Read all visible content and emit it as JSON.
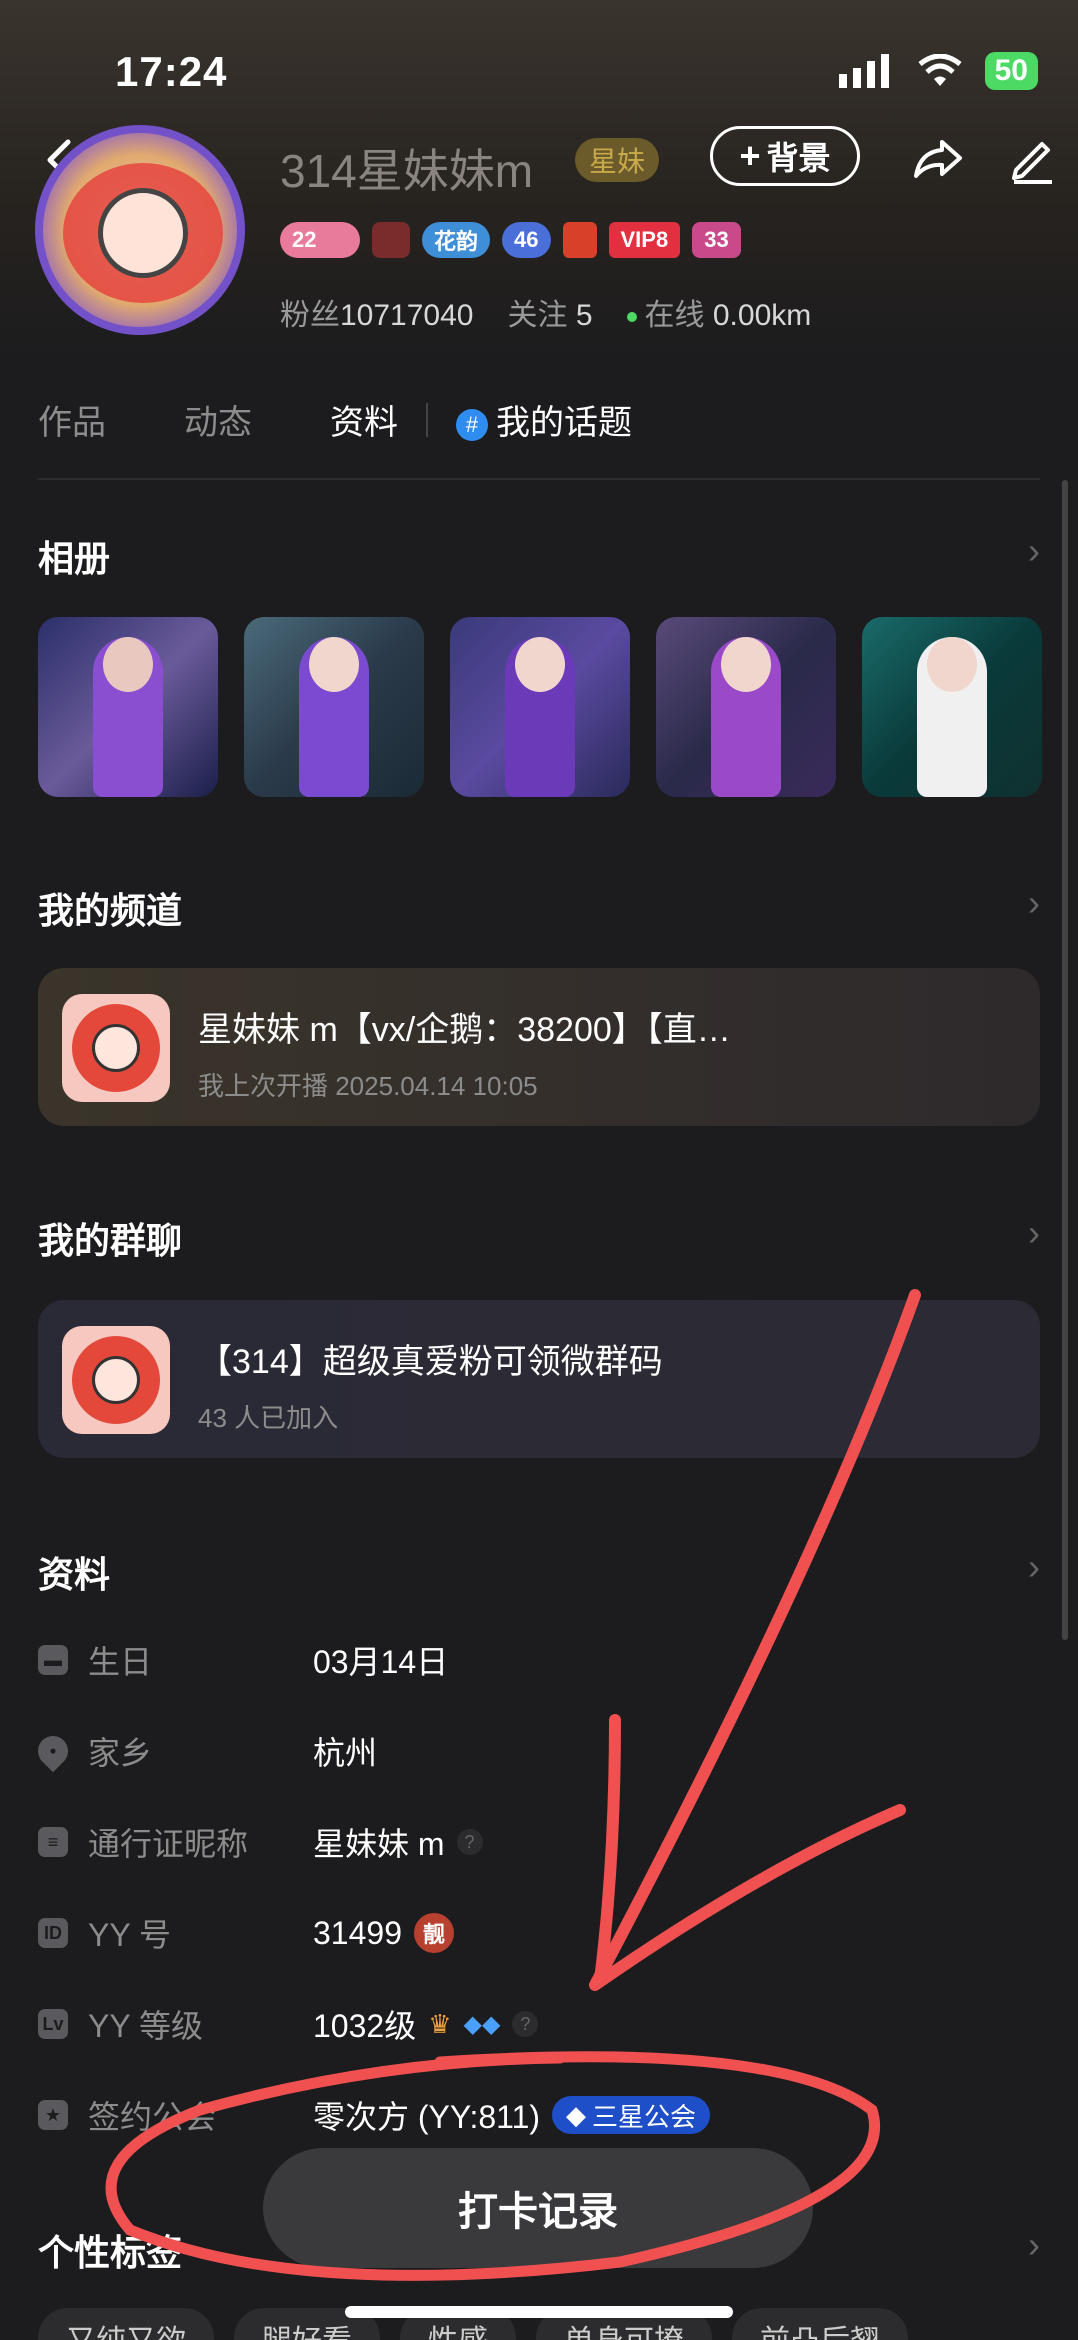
{
  "status_bar": {
    "time": "17:24",
    "battery": "50"
  },
  "profile": {
    "nickname": "314星妹妹m",
    "nick_tag": "星妹",
    "bg_button_label": "背景",
    "badges": [
      "22",
      "",
      "花韵",
      "46",
      "",
      "VIP8",
      "33"
    ],
    "fans_label": "粉丝",
    "fans_count": "10717040",
    "follow_label": "关注",
    "follow_count": "5",
    "online_label": "在线",
    "distance": "0.00km"
  },
  "tabs": [
    {
      "label": "作品"
    },
    {
      "label": "动态"
    },
    {
      "label": "资料"
    },
    {
      "label": "我的话题"
    }
  ],
  "album": {
    "title": "相册"
  },
  "channel": {
    "title": "我的频道",
    "name": "星妹妹 m【vx/企鹅：38200】【直…",
    "last_live": "我上次开播 2025.04.14 10:05"
  },
  "group": {
    "title": "我的群聊",
    "name": "【314】超级真爱粉可领微群码",
    "members": "43 人已加入"
  },
  "info": {
    "title": "资料",
    "rows": [
      {
        "icon": "cake-icon",
        "label": "生日",
        "value": "03月14日"
      },
      {
        "icon": "location-icon",
        "label": "家乡",
        "value": "杭州"
      },
      {
        "icon": "id-card-icon",
        "label": "通行证昵称",
        "value": "星妹妹 m"
      },
      {
        "icon": "id-icon",
        "label": "YY 号",
        "value": "31499"
      },
      {
        "icon": "level-icon",
        "label": "YY 等级",
        "value": "1032级"
      },
      {
        "icon": "shield-icon",
        "label": "签约公会",
        "value": "零次方 (YY:811)"
      }
    ],
    "liang_label": "靓",
    "guild_badge": "三星公会"
  },
  "personal_tags": {
    "title": "个性标签",
    "chips": [
      "又纯又欲",
      "腿好看",
      "性感",
      "单身可撩",
      "前凸后翘"
    ]
  },
  "checkin_button": "打卡记录",
  "colors": {
    "annotation_red": "#f05050",
    "guild_blue": "#1e4fc9",
    "online_green": "#4cd964"
  }
}
